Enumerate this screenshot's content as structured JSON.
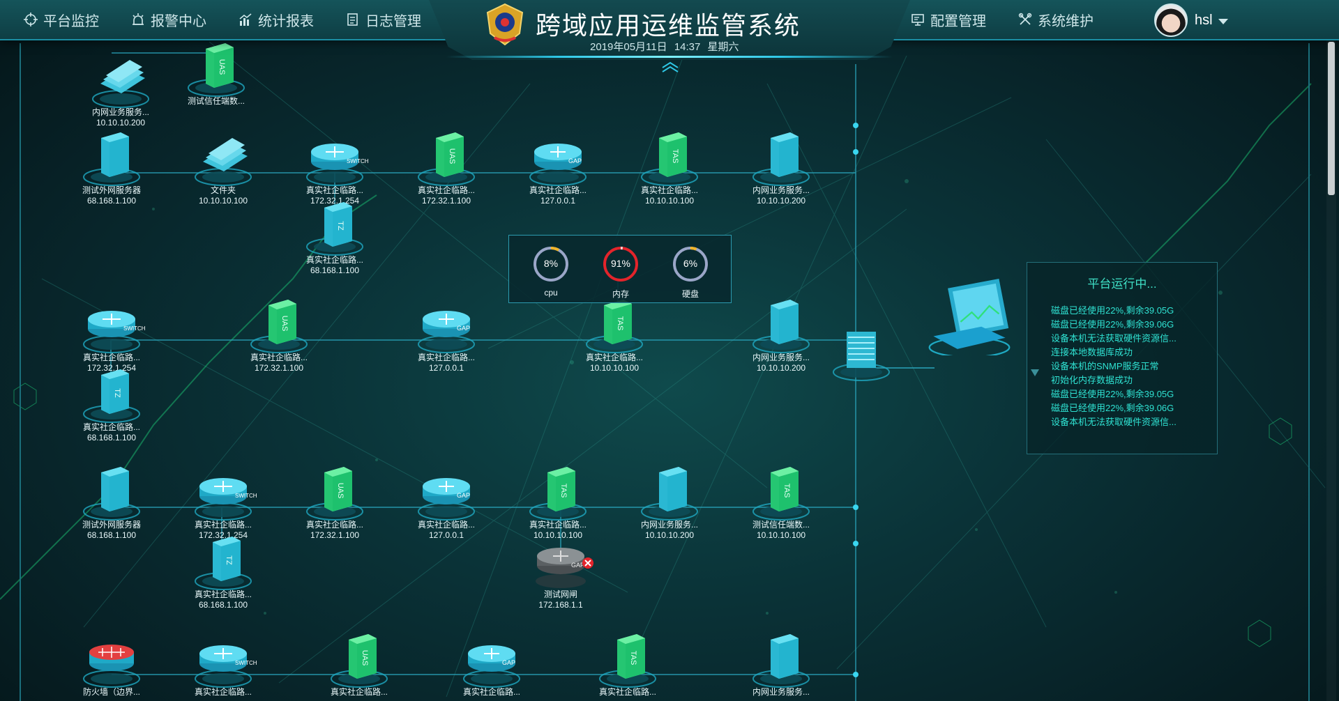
{
  "header": {
    "title": "跨域应用运维监管系统",
    "date": "2019年05月11日",
    "time": "14:37",
    "weekday": "星期六",
    "nav_left": [
      {
        "label": "平台监控",
        "icon": "crosshair-icon"
      },
      {
        "label": "报警中心",
        "icon": "alarm-icon"
      },
      {
        "label": "统计报表",
        "icon": "chart-icon"
      },
      {
        "label": "日志管理",
        "icon": "document-icon"
      }
    ],
    "nav_right": [
      {
        "label": "配置管理",
        "icon": "monitor-icon"
      },
      {
        "label": "系统维护",
        "icon": "tools-icon"
      }
    ],
    "user": {
      "name": "hsl"
    }
  },
  "stats": {
    "cpu": {
      "label": "cpu",
      "value": "8%",
      "percent": 8
    },
    "memory": {
      "label": "内存",
      "value": "91%",
      "percent": 91
    },
    "disk": {
      "label": "硬盘",
      "value": "6%",
      "percent": 6
    }
  },
  "colors": {
    "accent": "#2ec7e6",
    "server": "#1fb4cc",
    "security": "#25c773",
    "alarm": "#e3242b",
    "gauge_normal": "#9aa6c8",
    "gauge_warn": "#f0b429"
  },
  "status_panel": {
    "title": "平台运行中...",
    "logs": [
      "磁盘已经使用22%,剩余39.05G",
      "磁盘已经使用22%,剩余39.06G",
      "设备本机无法获取硬件资源信...",
      "连接本地数据库成功",
      "设备本机的SNMP服务正常",
      "初始化内存数据成功",
      "磁盘已经使用22%,剩余39.05G",
      "磁盘已经使用22%,剩余39.06G",
      "设备本机无法获取硬件资源信..."
    ]
  },
  "nodes": [
    {
      "name": "内网业务服务...",
      "ip": "10.10.10.200",
      "icon": "folder-icon"
    },
    {
      "name": "测试信任端数...",
      "ip": "",
      "icon": "uas-device-icon"
    },
    {
      "name": "测试外网服务器",
      "ip": "68.168.1.100",
      "icon": "server-icon"
    },
    {
      "name": "文件夹",
      "ip": "10.10.10.100",
      "icon": "folder-icon"
    },
    {
      "name": "真实社企临路...",
      "ip": "172.32.1.254",
      "icon": "switch-icon"
    },
    {
      "name": "真实社企临路...",
      "ip": "172.32.1.100",
      "icon": "uas-device-icon"
    },
    {
      "name": "真实社企临路...",
      "ip": "127.0.0.1",
      "icon": "gap-icon"
    },
    {
      "name": "真实社企临路...",
      "ip": "10.10.10.100",
      "icon": "tas-device-icon"
    },
    {
      "name": "内网业务服务...",
      "ip": "10.10.10.200",
      "icon": "server-icon"
    },
    {
      "name": "真实社企临路...",
      "ip": "68.168.1.100",
      "icon": "tz-device-icon"
    },
    {
      "name": "真实社企临路...",
      "ip": "172.32.1.254",
      "icon": "switch-icon"
    },
    {
      "name": "真实社企临路...",
      "ip": "172.32.1.100",
      "icon": "uas-device-icon"
    },
    {
      "name": "真实社企临路...",
      "ip": "127.0.0.1",
      "icon": "gap-icon"
    },
    {
      "name": "真实社企临路...",
      "ip": "10.10.10.100",
      "icon": "tas-device-icon"
    },
    {
      "name": "内网业务服务...",
      "ip": "10.10.10.200",
      "icon": "server-icon"
    },
    {
      "name": "真实社企临路...",
      "ip": "68.168.1.100",
      "icon": "tz-device-icon"
    },
    {
      "name": "测试外网服务器",
      "ip": "68.168.1.100",
      "icon": "server-icon"
    },
    {
      "name": "真实社企临路...",
      "ip": "172.32.1.254",
      "icon": "switch-icon"
    },
    {
      "name": "真实社企临路...",
      "ip": "172.32.1.100",
      "icon": "uas-device-icon"
    },
    {
      "name": "真实社企临路...",
      "ip": "127.0.0.1",
      "icon": "gap-icon"
    },
    {
      "name": "真实社企临路...",
      "ip": "10.10.10.100",
      "icon": "tas-device-icon"
    },
    {
      "name": "内网业务服务...",
      "ip": "10.10.10.200",
      "icon": "server-icon"
    },
    {
      "name": "测试信任端数...",
      "ip": "10.10.10.100",
      "icon": "tas-device-icon"
    },
    {
      "name": "真实社企临路...",
      "ip": "68.168.1.100",
      "icon": "tz-device-icon"
    },
    {
      "name": "测试网闸",
      "ip": "172.168.1.1",
      "icon": "gap-offline-icon"
    },
    {
      "name": "防火墙（边界...",
      "ip": "",
      "icon": "firewall-icon"
    },
    {
      "name": "真实社企临路...",
      "ip": "",
      "icon": "switch-icon"
    },
    {
      "name": "真实社企临路...",
      "ip": "",
      "icon": "uas-device-icon"
    },
    {
      "name": "真实社企临路...",
      "ip": "",
      "icon": "gap-icon"
    },
    {
      "name": "真实社企临路...",
      "ip": "",
      "icon": "tas-device-icon"
    },
    {
      "name": "内网业务服务...",
      "ip": "",
      "icon": "server-icon"
    },
    {
      "name": "",
      "ip": "",
      "icon": "server-stack-icon"
    },
    {
      "name": "",
      "ip": "",
      "icon": "platform-laptop-icon"
    }
  ]
}
